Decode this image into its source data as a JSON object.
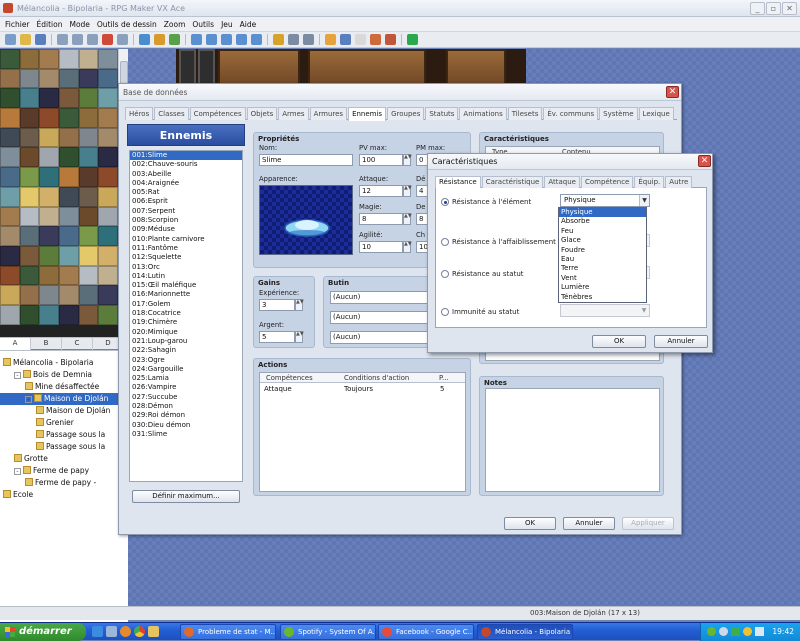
{
  "app": {
    "title": "Mélancolia - Bipolaria - RPG Maker VX Ace",
    "menu": [
      "Fichier",
      "Édition",
      "Mode",
      "Outils de dessin",
      "Zoom",
      "Outils",
      "Jeu",
      "Aide"
    ],
    "toolbar_icons": [
      "new-icon",
      "open-icon",
      "save-icon",
      "cut-icon",
      "copy-icon",
      "paste-icon",
      "delete-icon",
      "undo-icon",
      "layer-map-icon",
      "layer-event-icon",
      "region-icon",
      "pencil-icon",
      "rectangle-icon",
      "ellipse-icon",
      "fill-icon",
      "shadow-pen-icon",
      "zoom-1x-icon",
      "zoom-half-icon",
      "zoom-quarter-icon",
      "database-icon",
      "resource-manager-icon",
      "script-editor-icon",
      "sound-test-icon",
      "character-generator-icon",
      "playtest-icon"
    ],
    "tileset_tabs": [
      "A",
      "B",
      "C",
      "D"
    ],
    "status_text": "003:Maison de Djolán (17 x 13)"
  },
  "map_tree": [
    {
      "label": "Mélancolia - Bipolaria",
      "level": 0,
      "toggle": ""
    },
    {
      "label": "Bois de Demnia",
      "level": 1,
      "toggle": "-"
    },
    {
      "label": "Mine désaffectée",
      "level": 2,
      "toggle": ""
    },
    {
      "label": "Maison de Djolán",
      "level": 2,
      "toggle": "-",
      "selected": true
    },
    {
      "label": "Maison de Djolán",
      "level": 3,
      "toggle": ""
    },
    {
      "label": "Grenier",
      "level": 3,
      "toggle": ""
    },
    {
      "label": "Passage sous la",
      "level": 3,
      "toggle": ""
    },
    {
      "label": "Passage sous la",
      "level": 3,
      "toggle": ""
    },
    {
      "label": "Grotte",
      "level": 1,
      "toggle": ""
    },
    {
      "label": "Ferme de papy",
      "level": 1,
      "toggle": "-"
    },
    {
      "label": "Ferme de papy -",
      "level": 2,
      "toggle": ""
    },
    {
      "label": "Ecole",
      "level": 0,
      "toggle": ""
    }
  ],
  "database": {
    "title": "Base de données",
    "tabs": [
      "Héros",
      "Classes",
      "Compétences",
      "Objets",
      "Armes",
      "Armures",
      "Ennemis",
      "Groupes",
      "Statuts",
      "Animations",
      "Tilesets",
      "Év. communs",
      "Système",
      "Lexique"
    ],
    "active_tab": 6,
    "list_header": "Ennemis",
    "enemies": [
      "001:Slime",
      "002:Chauve-souris",
      "003:Abeille",
      "004:Araignée",
      "005:Rat",
      "006:Esprit",
      "007:Serpent",
      "008:Scorpion",
      "009:Méduse",
      "010:Plante carnivore",
      "011:Fantôme",
      "012:Squelette",
      "013:Orc",
      "014:Lutin",
      "015:Œil maléfique",
      "016:Marionnette",
      "017:Golem",
      "018:Cocatrice",
      "019:Chimère",
      "020:Mimique",
      "021:Loup-garou",
      "022:Sahagin",
      "023:Ogre",
      "024:Gargouille",
      "025:Lamia",
      "026:Vampire",
      "027:Succube",
      "028:Démon",
      "029:Roi démon",
      "030:Dieu démon",
      "031:Slime"
    ],
    "max_button": "Définir maximum...",
    "props": {
      "title": "Propriétés",
      "name_label": "Nom:",
      "name_value": "Slime",
      "hp_label": "PV max:",
      "hp_value": "100",
      "mp_label": "PM max:",
      "mp_value": "0",
      "appearance_label": "Apparence:",
      "atk_label": "Attaque:",
      "atk_value": "12",
      "def_label": "Dé",
      "def_value": "4",
      "mag_label": "Magie:",
      "mag_value": "8",
      "mdf_label": "De",
      "mdf_value": "8",
      "agi_label": "Agilité:",
      "agi_value": "10",
      "luk_label": "Ch",
      "luk_value": "10"
    },
    "gains": {
      "title": "Gains",
      "exp_label": "Expérience:",
      "exp_value": "3",
      "gold_label": "Argent:",
      "gold_value": "5"
    },
    "loot": {
      "title": "Butin",
      "items": [
        "(Aucun)",
        "(Aucun)",
        "(Aucun)"
      ]
    },
    "actions": {
      "title": "Actions",
      "columns": [
        "Compétences",
        "Conditions d'action",
        "P..."
      ],
      "rows": [
        {
          "skill": "Attaque",
          "condition": "Toujours",
          "priority": "5"
        }
      ]
    },
    "features": {
      "title": "Caractéristiques",
      "columns": [
        "Type",
        "Contenu"
      ]
    },
    "notes_title": "Notes",
    "ok": "OK",
    "cancel": "Annuler",
    "apply": "Appliquer"
  },
  "features_dialog": {
    "title": "Caractéristiques",
    "tabs": [
      "Résistance",
      "Caractéristique",
      "Attaque",
      "Compétence",
      "Équip.",
      "Autre"
    ],
    "options": [
      {
        "label": "Résistance à l'élément",
        "selected": true
      },
      {
        "label": "Résistance à l'affaiblissement",
        "selected": false
      },
      {
        "label": "Résistance au statut",
        "selected": false
      },
      {
        "label": "Immunité au statut",
        "selected": false
      }
    ],
    "element_select": "Physique",
    "dropdown_options": [
      "Physique",
      "Absorbe",
      "Feu",
      "Glace",
      "Foudre",
      "Eau",
      "Terre",
      "Vent",
      "Lumière",
      "Ténèbres"
    ],
    "ok": "OK",
    "cancel": "Annuler"
  },
  "taskbar": {
    "start": "démarrer",
    "tasks": [
      {
        "label": "Probleme de stat - M...",
        "color": "#e06a2a"
      },
      {
        "label": "Spotify - System Of A...",
        "color": "#6ab82a"
      },
      {
        "label": "Facebook - Google C...",
        "color": "#e64b3c"
      },
      {
        "label": "Mélancolia - Bipolaria ...",
        "color": "#c4472e",
        "active": true
      }
    ],
    "clock": "19:42"
  }
}
